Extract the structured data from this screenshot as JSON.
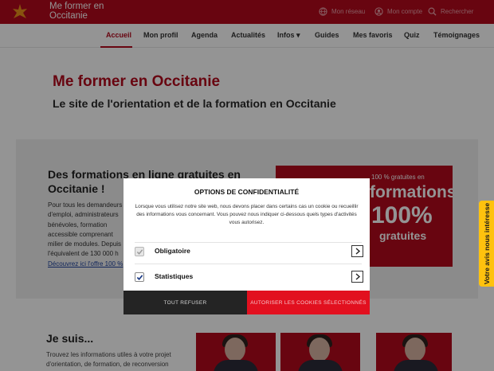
{
  "header": {
    "site_name": "Me former en Occitanie",
    "links": [
      {
        "label": "Mon réseau",
        "icon": "globe-icon"
      },
      {
        "label": "Mon compte",
        "icon": "user-icon"
      },
      {
        "label": "Rechercher",
        "icon": "search-icon"
      }
    ]
  },
  "nav": {
    "items": [
      "Accueil",
      "Mon profil",
      "Agenda",
      "Actualités",
      "Infos",
      "Guides",
      "Mes favoris",
      "Quiz",
      "Témoignages"
    ],
    "infos_caret": "▾",
    "active": "Accueil"
  },
  "hero": {
    "title": "Me former en Occitanie",
    "subtitle": "Le site de l'orientation et de la formation en Occitanie"
  },
  "feature": {
    "heading": "Des formations en ligne gratuites en Occitanie !",
    "text": "Pour tous les demandeurs d'emploi, administrateurs bénévoles, formation accessible comprenant milier de modules. Depuis l'équivalent de 130 000 h",
    "link": "Découvrez ici l'offre 100 %",
    "promo_top": "100 % gratuites en",
    "promo_big1": "formations",
    "promo_big2": "100%",
    "promo_small": "gratuites"
  },
  "je_suis": {
    "heading": "Je suis...",
    "text": "Trouvez les informations utiles à votre projet d'orientation, de formation, de reconversion"
  },
  "feedback_tab": "Votre avis nous intéresse",
  "cookie_modal": {
    "title": "OPTIONS DE CONFIDENTIALITÉ",
    "description": "Lorsque vous utilisez notre site web, nous devons placer dans certains cas un cookie ou recueillir des informations vous concernant. Vous pouvez nous indiquer ci-dessous quels types d'activités vous autorisez.",
    "options": [
      {
        "label": "Obligatoire",
        "checked": true,
        "disabled": true
      },
      {
        "label": "Statistiques",
        "checked": true,
        "disabled": false
      }
    ],
    "refuse_label": "TOUT REFUSER",
    "accept_label": "AUTORISER LES COOKIES SÉLECTIONNÉS"
  },
  "colors": {
    "brand_red": "#b3091d",
    "accept_red": "#e2101f",
    "refuse_dark": "#242424",
    "feedback_yellow": "#ffc20e"
  }
}
